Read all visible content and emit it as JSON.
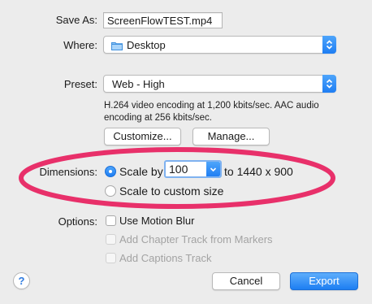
{
  "save_as": {
    "label": "Save As:",
    "value": "ScreenFlowTEST.mp4"
  },
  "where": {
    "label": "Where:",
    "value": "Desktop",
    "icon": "folder-icon"
  },
  "preset": {
    "label": "Preset:",
    "value": "Web - High",
    "description_line1": "H.264 video encoding at 1,200 kbits/sec.  AAC audio",
    "description_line2": "encoding at 256 kbits/sec."
  },
  "buttons": {
    "customize": "Customize...",
    "manage": "Manage...",
    "cancel": "Cancel",
    "export": "Export"
  },
  "dimensions": {
    "label": "Dimensions:",
    "scale_by_label": "Scale by",
    "scale_value": "100",
    "result_text": "to 1440 x 900",
    "custom_label": "Scale to custom size",
    "selected": "scale_by"
  },
  "options": {
    "label": "Options:",
    "items": [
      {
        "label": "Use Motion Blur",
        "checked": false,
        "enabled": true
      },
      {
        "label": "Add Chapter Track from Markers",
        "checked": false,
        "enabled": false
      },
      {
        "label": "Add Captions Track",
        "checked": false,
        "enabled": false
      }
    ]
  },
  "help": {
    "label": "?"
  },
  "colors": {
    "accent": "#2680f5",
    "highlight_ellipse": "#e8306a",
    "background": "#ececec"
  }
}
